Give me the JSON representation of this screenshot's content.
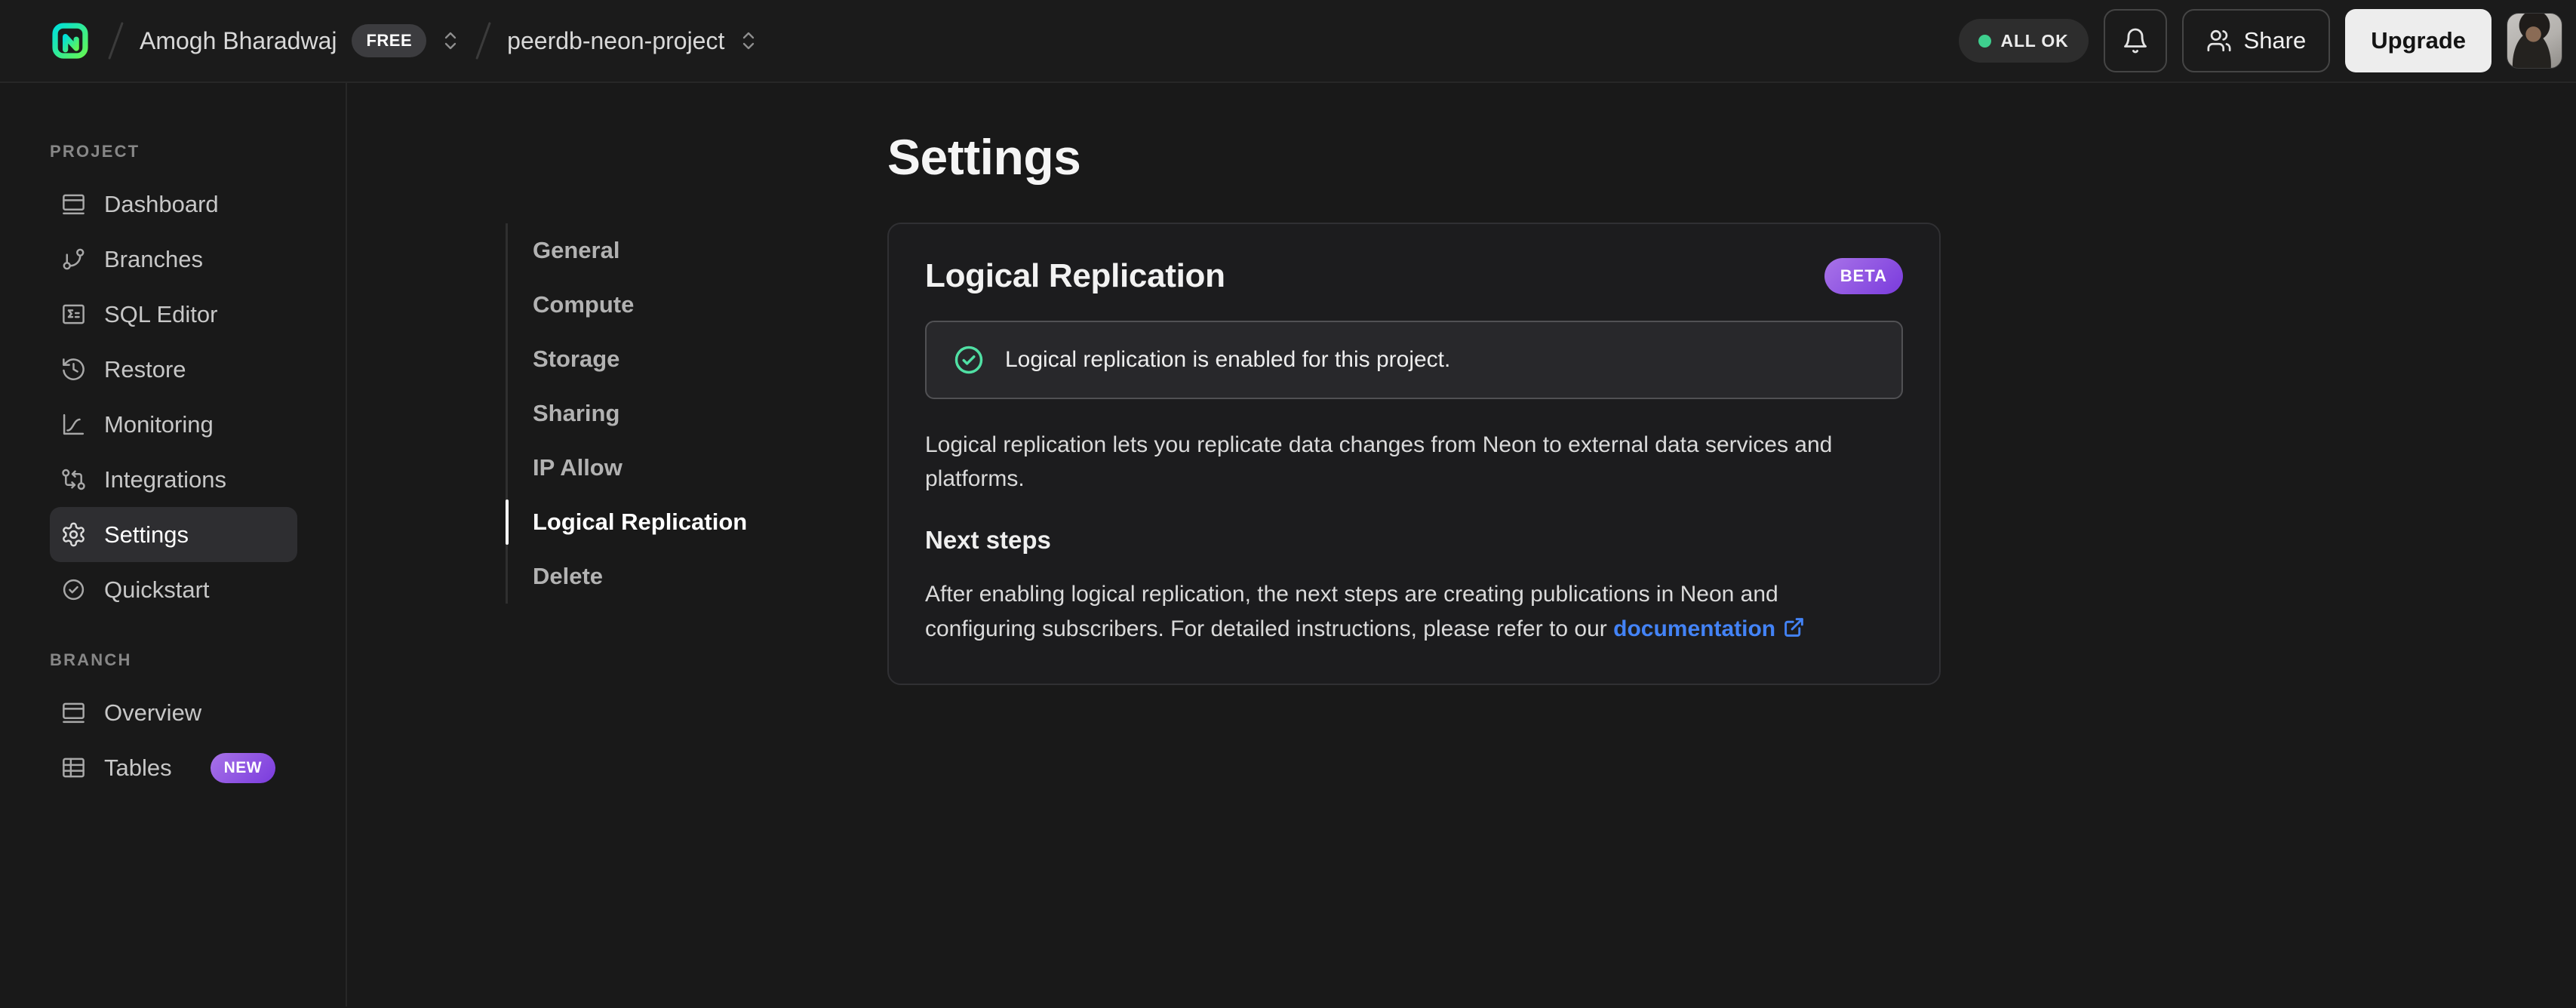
{
  "topbar": {
    "org_name": "Amogh Bharadwaj",
    "org_plan_badge": "FREE",
    "project_name": "peerdb-neon-project",
    "status_badge": "ALL OK",
    "share_label": "Share",
    "upgrade_label": "Upgrade"
  },
  "sidebar": {
    "sections": [
      {
        "label": "PROJECT",
        "items": [
          {
            "label": "Dashboard",
            "icon": "dashboard-icon"
          },
          {
            "label": "Branches",
            "icon": "git-branch-icon"
          },
          {
            "label": "SQL Editor",
            "icon": "sql-editor-icon"
          },
          {
            "label": "Restore",
            "icon": "history-icon"
          },
          {
            "label": "Monitoring",
            "icon": "monitoring-chart-icon"
          },
          {
            "label": "Integrations",
            "icon": "integrations-icon"
          },
          {
            "label": "Settings",
            "icon": "gear-icon",
            "active": true
          },
          {
            "label": "Quickstart",
            "icon": "check-circle-icon"
          }
        ]
      },
      {
        "label": "BRANCH",
        "items": [
          {
            "label": "Overview",
            "icon": "overview-icon"
          },
          {
            "label": "Tables",
            "icon": "table-icon",
            "badge": "NEW"
          }
        ]
      }
    ]
  },
  "settings_nav": {
    "items": [
      {
        "label": "General"
      },
      {
        "label": "Compute"
      },
      {
        "label": "Storage"
      },
      {
        "label": "Sharing"
      },
      {
        "label": "IP Allow"
      },
      {
        "label": "Logical Replication",
        "active": true
      },
      {
        "label": "Delete"
      }
    ]
  },
  "main": {
    "page_title": "Settings",
    "card": {
      "title": "Logical Replication",
      "badge": "BETA",
      "alert_text": "Logical replication is enabled for this project.",
      "description": "Logical replication lets you replicate data changes from Neon to external data services and platforms.",
      "next_steps_title": "Next steps",
      "next_steps_text": "After enabling logical replication, the next steps are creating publications in Neon and configuring subscribers. For detailed instructions, please refer to our ",
      "link_label": "documentation"
    }
  },
  "colors": {
    "brand_gradient_start": "#00e0d9",
    "brand_gradient_end": "#62f655",
    "status_green": "#3ecf8e",
    "success_green": "#50e0a4",
    "badge_purple_start": "#a873e8",
    "badge_purple_end": "#7a3bdd",
    "link_blue": "#4383f6"
  }
}
